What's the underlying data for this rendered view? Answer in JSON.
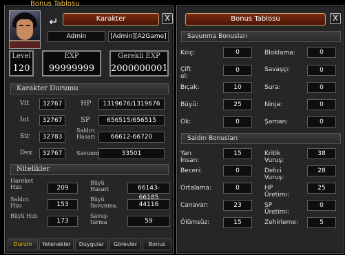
{
  "top_title": "Bonus Tablosu",
  "character": {
    "title": "Karakter",
    "close": "X",
    "back_arrow": "↵",
    "name": "Admin",
    "guild": "[Admin][A2Game]",
    "level_label": "Level",
    "level": "120",
    "exp_label": "EXP",
    "exp": "99999999",
    "req_exp_label": "Gerekli  EXP",
    "req_exp": "2000000001",
    "status_header": "Karakter Durumu",
    "stats": {
      "vit_label": "Vit",
      "vit": "32767",
      "int_label": "Int",
      "int": "32767",
      "str_label": "Str",
      "str": "32783",
      "dex_label": "Dex",
      "dex": "32767",
      "hp_label": "HP",
      "hp": "1319676/1319676",
      "sp_label": "SP",
      "sp": "656515/656515",
      "attack_label": "Saldırı Hasarı",
      "attack": "66612-66720",
      "defense_label": "Savunma",
      "defense": "33501"
    },
    "features_header": "Nitelikler",
    "features": {
      "move_speed_label": "Hareket Hızı",
      "move_speed": "209",
      "attack_speed_label": "Saldırı Hızı",
      "attack_speed": "153",
      "magic_speed_label": "Büyü Hızı",
      "magic_speed": "173",
      "magic_damage_label": "Büyü Hasarı",
      "magic_damage": "66143-66185",
      "magic_defense_label": "Büyü Savunma.",
      "magic_defense": "44116",
      "dodge_label": "Savuş-turma",
      "dodge": "59"
    },
    "tabs": [
      "Durum",
      "Yetenekler",
      "Duygular",
      "Görevler",
      "Bonus"
    ],
    "active_tab": "Durum"
  },
  "bonus": {
    "title": "Bonus Tablosu",
    "close": "X",
    "defense_header": "Savunma Bonusları",
    "defense": [
      {
        "label": "Kılıç:",
        "value": "0"
      },
      {
        "label": "Bloklama:",
        "value": "0"
      },
      {
        "label": "Çift el:",
        "value": "0"
      },
      {
        "label": "Savaşçı:",
        "value": "0"
      },
      {
        "label": "Bıçak:",
        "value": "10"
      },
      {
        "label": "Sura:",
        "value": "0"
      },
      {
        "label": "Büyü:",
        "value": "25"
      },
      {
        "label": "Ninja:",
        "value": "0"
      },
      {
        "label": "Ok:",
        "value": "0"
      },
      {
        "label": "Şaman:",
        "value": "0"
      }
    ],
    "attack_header": "Saldırı Bonusları",
    "attack": [
      {
        "label": "Yarı İnsan:",
        "value": "15"
      },
      {
        "label": "Kritik Vuruş:",
        "value": "38"
      },
      {
        "label": "Beceri:",
        "value": "0"
      },
      {
        "label": "Delici Vuruş:",
        "value": "28"
      },
      {
        "label": "Ortalama:",
        "value": "0"
      },
      {
        "label": "HP Üretimi:",
        "value": "25"
      },
      {
        "label": "Canavar:",
        "value": "23"
      },
      {
        "label": "SP Üretimi:",
        "value": "0"
      },
      {
        "label": "Ölümsüz:",
        "value": "15"
      },
      {
        "label": "Zehirleme:",
        "value": "5"
      }
    ]
  }
}
